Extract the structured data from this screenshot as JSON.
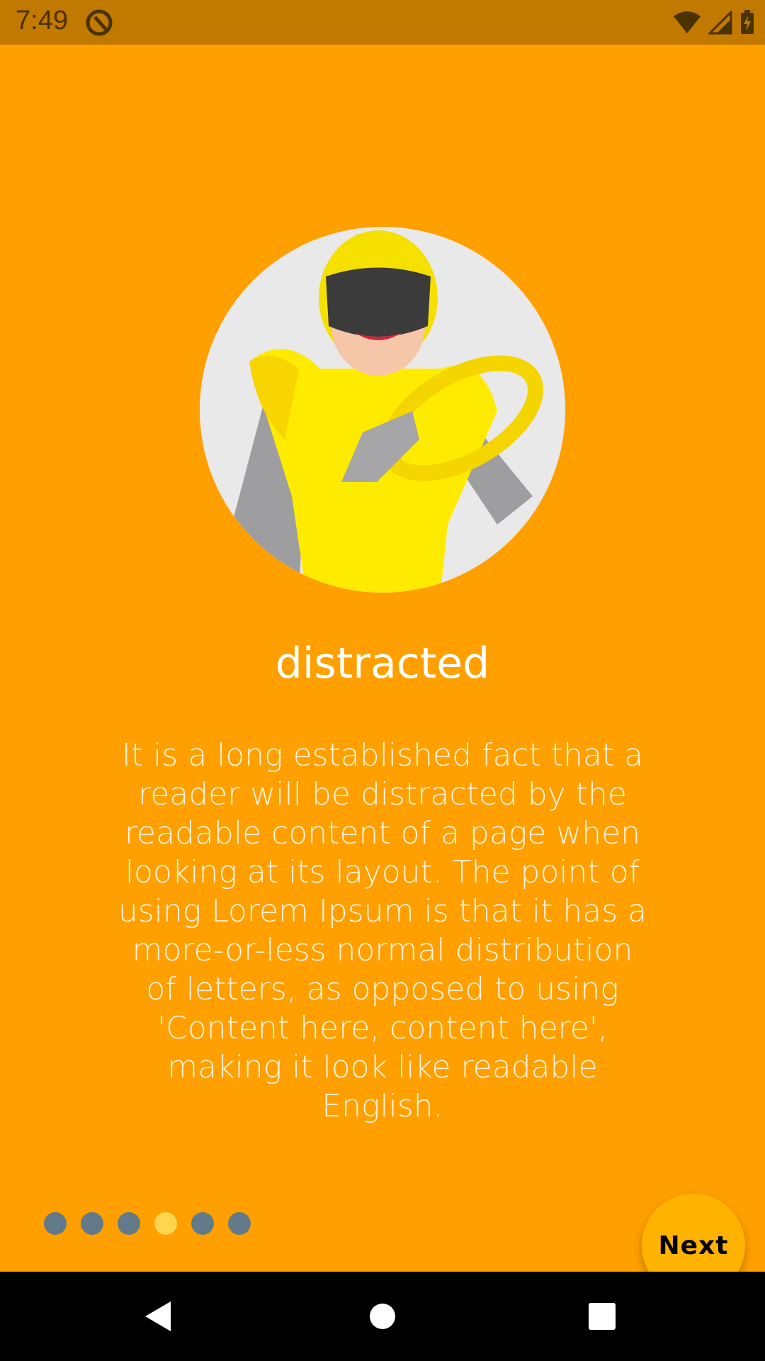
{
  "status": {
    "time": "7:49",
    "app_icon": "q-circle-icon",
    "signal_icons": [
      "wifi-icon",
      "cell-signal-icon",
      "battery-charging-icon"
    ]
  },
  "onboarding": {
    "title": "distracted",
    "description": "It is a long established fact that a reader will be distracted by the readable content of a page when looking at its layout. The point of using Lorem Ipsum is that it has a more-or-less normal distribution of letters, as opposed to using 'Content here, content here', making it look like readable English.",
    "page_count": 6,
    "active_page": 4,
    "next_label": "Next"
  },
  "colors": {
    "background": "#FFA000",
    "status_bar": "#C17900",
    "dot_inactive": "#637A8B",
    "dot_active": "#FFD54F",
    "next_button": "#FFB300"
  },
  "nav": {
    "icons": [
      "back-icon",
      "home-icon",
      "recents-icon"
    ]
  }
}
